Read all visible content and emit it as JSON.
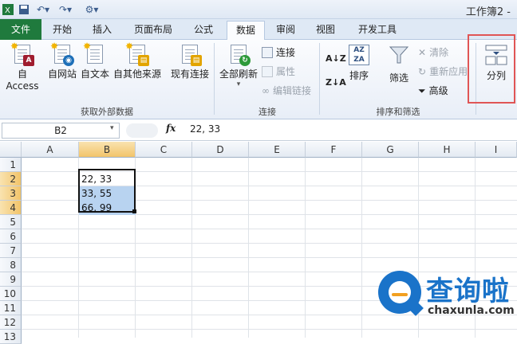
{
  "window": {
    "title": "工作簿2 -"
  },
  "qat": {
    "icons": [
      "excel-icon",
      "save-icon",
      "undo-icon",
      "redo-icon",
      "customize-icon"
    ]
  },
  "tabs": [
    {
      "label": "文件",
      "active": false
    },
    {
      "label": "开始",
      "active": false
    },
    {
      "label": "插入",
      "active": false
    },
    {
      "label": "页面布局",
      "active": false
    },
    {
      "label": "公式",
      "active": false
    },
    {
      "label": "数据",
      "active": true
    },
    {
      "label": "审阅",
      "active": false
    },
    {
      "label": "视图",
      "active": false
    },
    {
      "label": "开发工具",
      "active": false
    }
  ],
  "ribbon": {
    "external": {
      "access": "自 Access",
      "web": "自网站",
      "text": "自文本",
      "other": "自其他来源",
      "existing": "现有连接",
      "group_label": "获取外部数据"
    },
    "connections": {
      "refresh_all": "全部刷新",
      "connections": "连接",
      "properties": "属性",
      "edit_links": "编辑链接",
      "group_label": "连接"
    },
    "sort_filter": {
      "sort": "排序",
      "filter": "筛选",
      "clear": "清除",
      "reapply": "重新应用",
      "advanced": "高级",
      "group_label": "排序和筛选"
    },
    "tools": {
      "text_to_columns": "分列"
    }
  },
  "formula_bar": {
    "name_box": "B2",
    "fx": "fx",
    "formula": "22, 33"
  },
  "columns": [
    "A",
    "B",
    "C",
    "D",
    "E",
    "F",
    "G",
    "H",
    "I"
  ],
  "rows": [
    "1",
    "2",
    "3",
    "4",
    "5",
    "6",
    "7",
    "8",
    "9",
    "10",
    "11",
    "12",
    "13"
  ],
  "cells": {
    "B2": "22, 33",
    "B3": "33, 55",
    "B4": "66, 99"
  },
  "watermark": {
    "title": "查询啦",
    "url": "chaxunla.com"
  },
  "colors": {
    "file_tab": "#1f7a3d",
    "selection": "#b8d3f0",
    "highlight_box": "#e05555",
    "watermark": "#1a73c9"
  }
}
